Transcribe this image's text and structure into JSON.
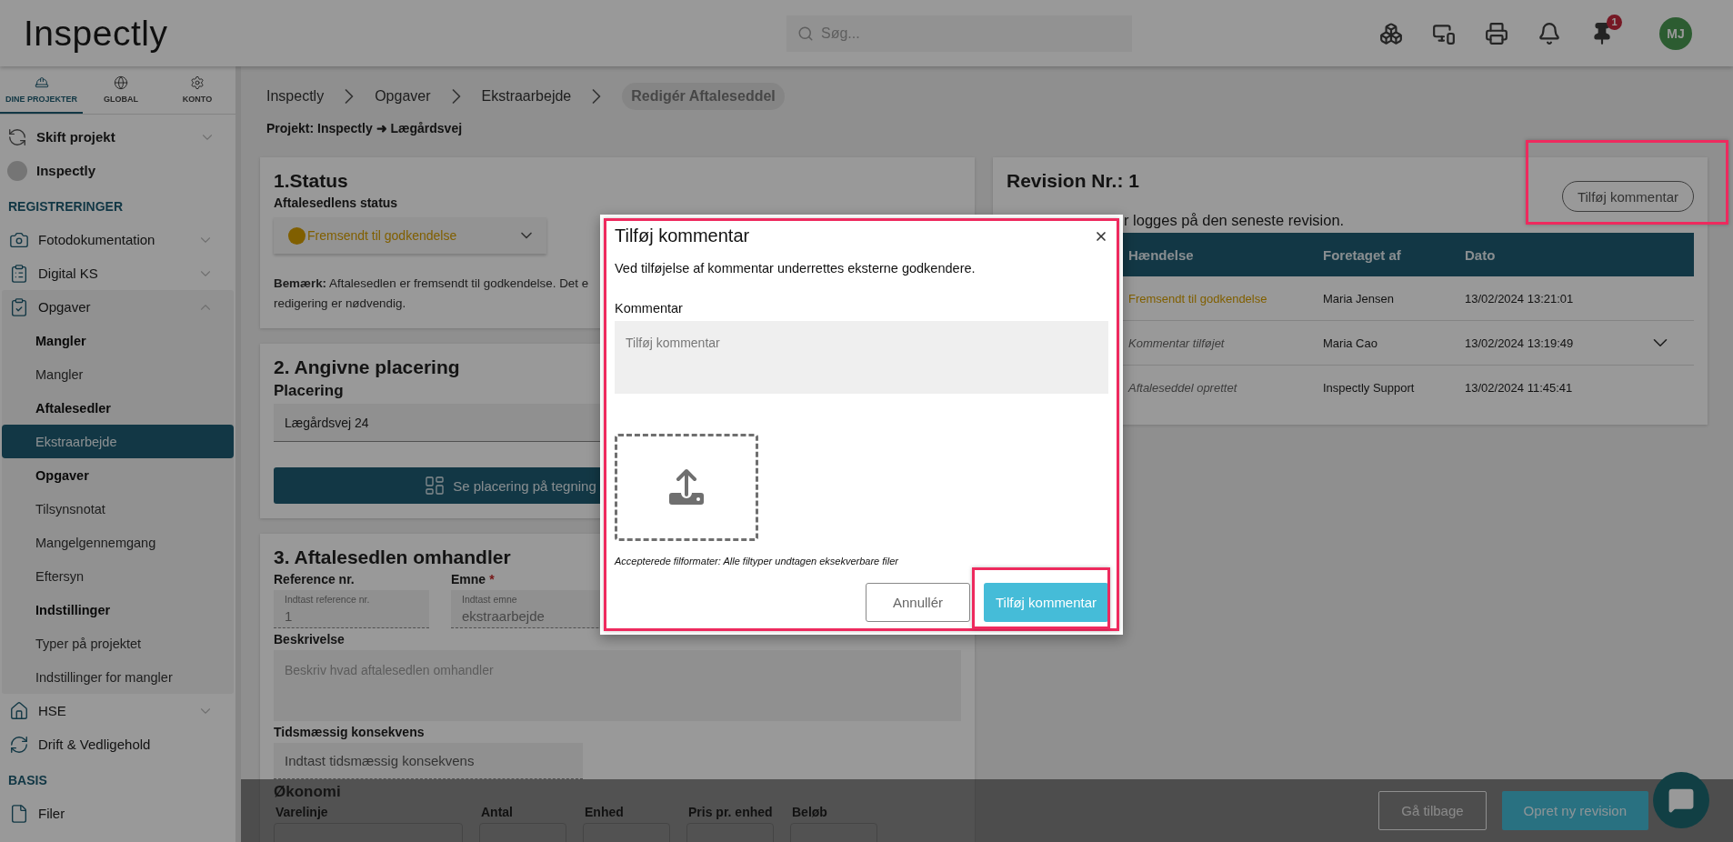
{
  "header": {
    "logo": "Inspectly",
    "search": {
      "placeholder": "Søg..."
    },
    "notification_count": "1",
    "avatar": "MJ"
  },
  "sidebar": {
    "tabs": [
      {
        "label": "DINE PROJEKTER",
        "selected": true
      },
      {
        "label": "GLOBAL",
        "selected": false
      },
      {
        "label": "KONTO",
        "selected": false
      }
    ],
    "project_items": [
      {
        "label": "Skift projekt",
        "kind": "switcher",
        "expanded": false
      },
      {
        "label": "Inspectly",
        "kind": "project"
      }
    ],
    "sections": [
      {
        "heading": "REGISTRERINGER",
        "items": [
          {
            "label": "Fotodokumentation",
            "expanded": false
          },
          {
            "label": "Digital KS",
            "expanded": false
          },
          {
            "label": "Opgaver",
            "expanded": true,
            "children": [
              {
                "label": "Mangler",
                "kind": "group"
              },
              {
                "label": "Mangler",
                "kind": "link",
                "selected": false
              },
              {
                "label": "Aftalesedler",
                "kind": "group"
              },
              {
                "label": "Ekstraarbejde",
                "kind": "link",
                "selected": true
              },
              {
                "label": "Opgaver",
                "kind": "group"
              },
              {
                "label": "Tilsynsnotat",
                "kind": "link",
                "selected": false
              },
              {
                "label": "Mangelgennemgang",
                "kind": "link",
                "selected": false
              },
              {
                "label": "Eftersyn",
                "kind": "link",
                "selected": false
              },
              {
                "label": "Indstillinger",
                "kind": "group"
              },
              {
                "label": "Typer på projektet",
                "kind": "link",
                "selected": false
              },
              {
                "label": "Indstillinger for mangler",
                "kind": "link",
                "selected": false
              }
            ]
          },
          {
            "label": "HSE",
            "expanded": false
          },
          {
            "label": "Drift & Vedligehold"
          }
        ]
      },
      {
        "heading": "BASIS",
        "items": [
          {
            "label": "Filer"
          }
        ]
      }
    ]
  },
  "breadcrumb": [
    {
      "label": "Inspectly",
      "current": false
    },
    {
      "label": "Opgaver",
      "current": false
    },
    {
      "label": "Ekstraarbejde",
      "current": false
    },
    {
      "label": "Redigér Aftaleseddel",
      "current": true
    }
  ],
  "project_line": "Projekt: Inspectly ➜ Lægårdsvej",
  "status_card": {
    "title": "1.Status",
    "label": "Aftalesedlens status",
    "status": "Fremsendt til godkendelse",
    "note_lines": [
      "**Bemærk:** Aftalesedlen er fremsendt til godkendelse. Det e",
      "redigering er nødvendig."
    ]
  },
  "placement_card": {
    "title": "2. Angivne placering",
    "label": "Placering",
    "value": "Lægårdsvej 24",
    "button": "Se placering på tegning"
  },
  "subject_card": {
    "title": "3. Aftalesedlen omhandler",
    "reference": {
      "label": "Reference nr.",
      "placeholder": "Indtast reference nr.",
      "value": "1"
    },
    "subject": {
      "label": "Emne",
      "required": "*",
      "placeholder": "Indtast emne",
      "value": "ekstraarbejde"
    },
    "description": {
      "label": "Beskrivelse",
      "placeholder": "Beskriv hvad aftalesedlen omhandler"
    },
    "time_impact": {
      "label": "Tidsmæssig konsekvens",
      "placeholder": "Indtast tidsmæssig konsekvens"
    },
    "economy": {
      "title": "Økonomi",
      "columns": [
        "Varelinje",
        "Antal",
        "Enhed",
        "Pris pr. enhed",
        "Beløb"
      ]
    }
  },
  "revision": {
    "title": "Revision Nr.: 1",
    "comment_button": {
      "label": "Tilføj kommentar",
      "highlighted": true
    },
    "note": "r logges på den seneste revision.",
    "columns": [
      "Hændelse",
      "Foretaget af",
      "Dato"
    ],
    "rows": [
      {
        "event": "Fremsendt til godkendelse",
        "kind": "status",
        "by": "Maria Jensen",
        "date": "13/02/2024 13:21:01"
      },
      {
        "event": "Kommentar tilføjet",
        "kind": "comment",
        "by": "Maria Cao",
        "date": "13/02/2024 13:19:49",
        "expanded": false
      },
      {
        "event": "Aftaleseddel oprettet",
        "kind": "comment",
        "by": "Inspectly Support",
        "date": "13/02/2024 11:45:41"
      }
    ]
  },
  "footer": {
    "buttons": [
      {
        "label": "Gå tilbage",
        "kind": "outline"
      },
      {
        "label": "Opret ny revision",
        "kind": "primary"
      }
    ]
  },
  "modal": {
    "title": "Tilføj kommentar",
    "highlighted": true,
    "description": "Ved tilføjelse af kommentar underrettes eksterne godkendere.",
    "field_label": "Kommentar",
    "placeholder": "Tilføj kommentar",
    "file_note": "Accepterede filformater: Alle filtyper undtagen eksekverbare filer",
    "buttons": [
      {
        "label": "Annullér",
        "kind": "outline",
        "highlighted": false
      },
      {
        "label": "Tilføj kommentar",
        "kind": "primary",
        "highlighted": true
      }
    ]
  }
}
